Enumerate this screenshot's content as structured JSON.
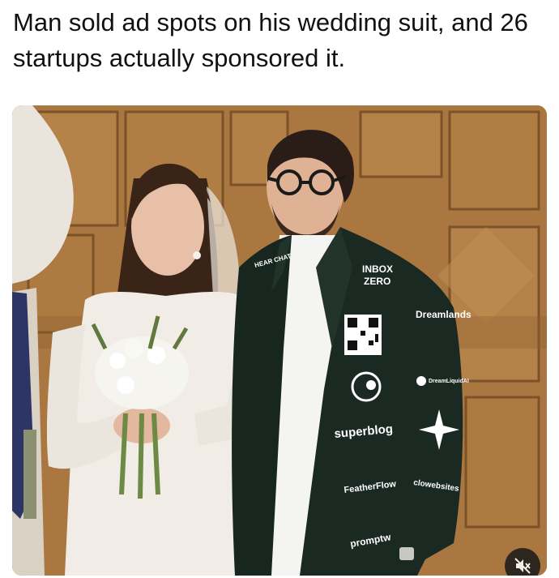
{
  "post": {
    "caption": "Man sold ad spots on his wedding suit, and 26 startups actually sponsored it."
  },
  "photo": {
    "sponsor_logos": [
      {
        "label": "HEAR CHAT"
      },
      {
        "label": "INBOX"
      },
      {
        "label": "ZERO"
      },
      {
        "label": "Dreamlands"
      },
      {
        "label": "DreamLiquidAI"
      },
      {
        "label": "superblog"
      },
      {
        "label": "FeatherFlow"
      },
      {
        "label": "clowebsites"
      },
      {
        "label": "promptw"
      }
    ]
  },
  "video_controls": {
    "mute_icon": "speaker-muted-icon"
  },
  "colors": {
    "wood": "#a9773f",
    "jacket": "#182620",
    "dress": "#f1ede6"
  }
}
